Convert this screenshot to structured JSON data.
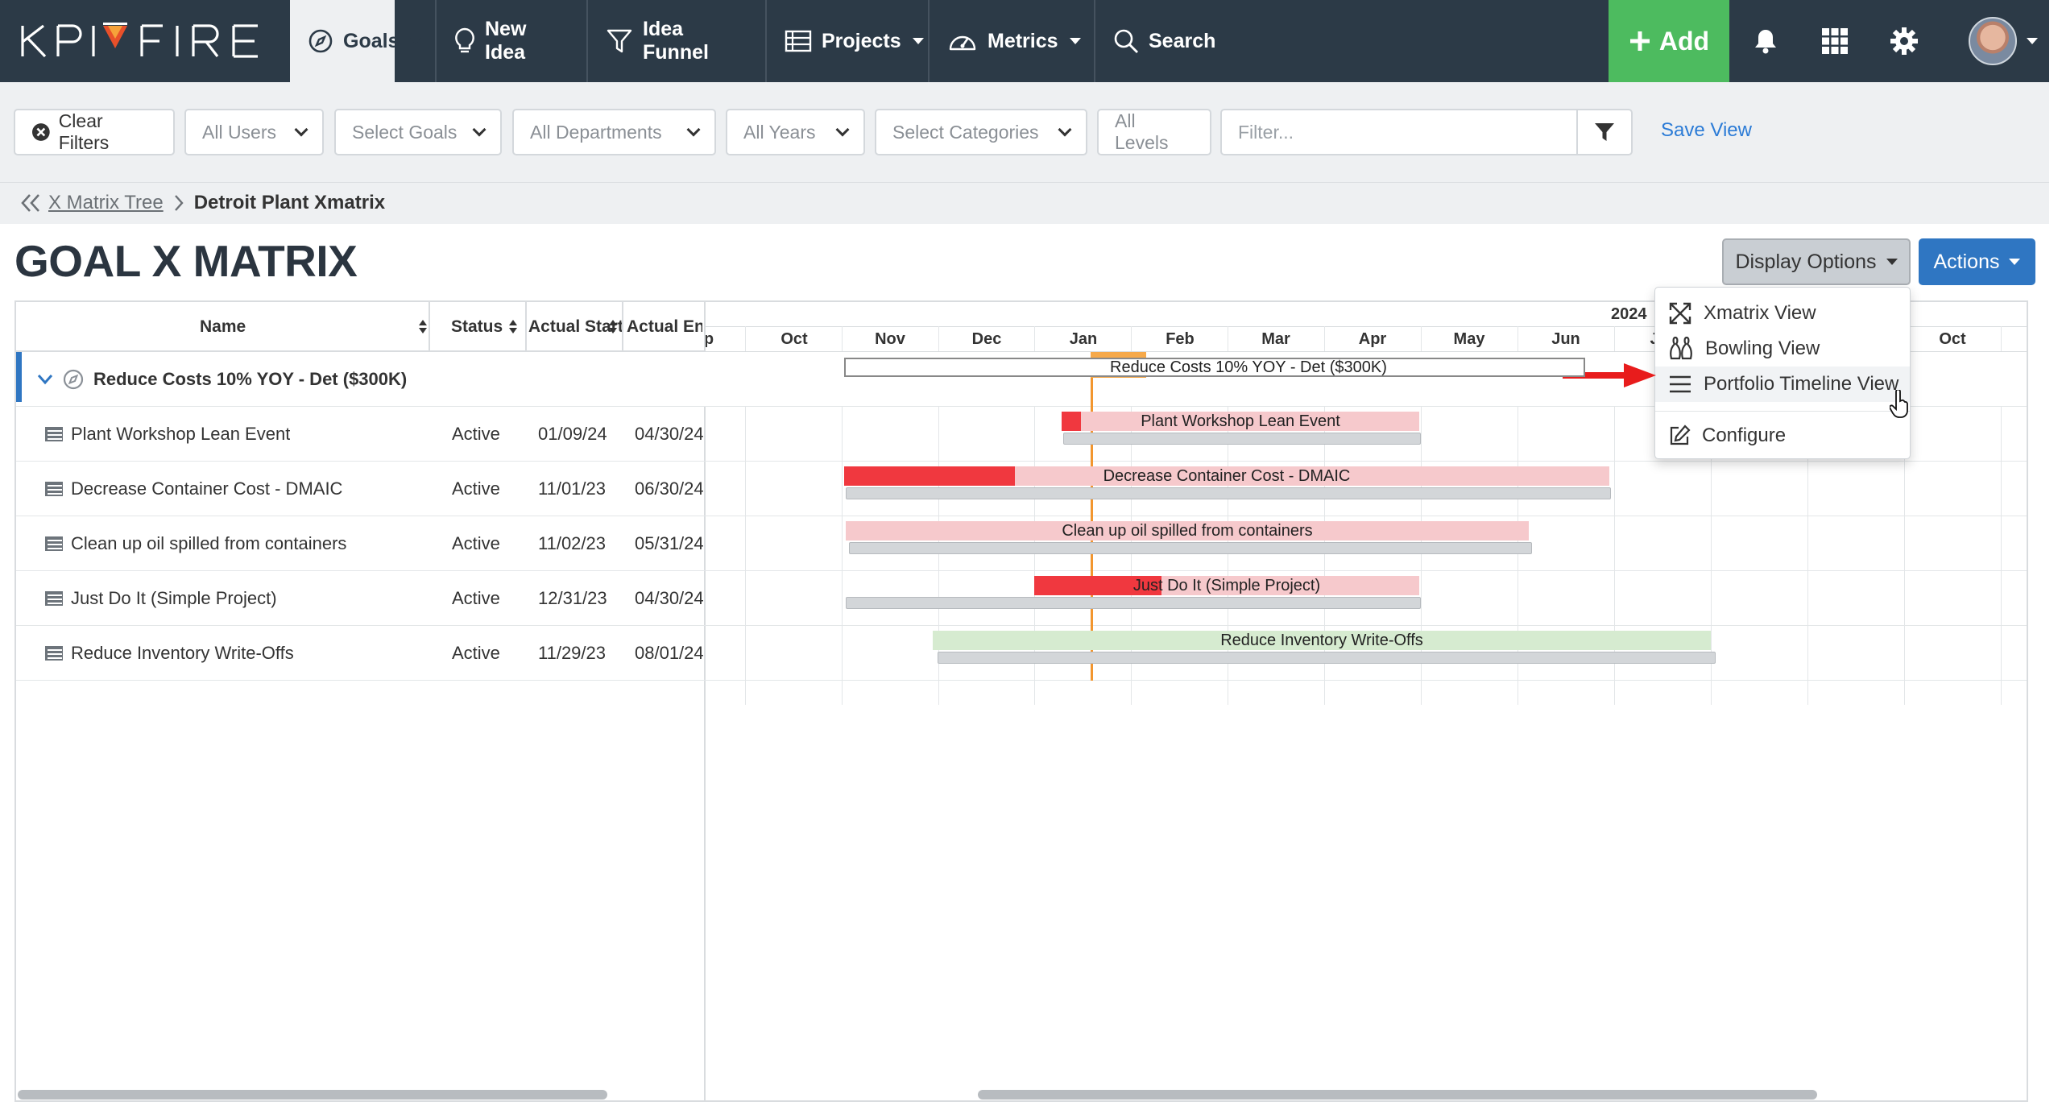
{
  "brand": {
    "name_left": "KPI",
    "name_right": "FIRE",
    "accent": "#e8502a",
    "nav_bg": "#2c3a47",
    "add_green": "#4dbb5f",
    "primary_blue": "#2f76c2",
    "bar_red": "#f0383f",
    "bar_pink": "#f6c9cc",
    "bar_green": "#d6ebd0",
    "today_orange": "#f2962f"
  },
  "nav": {
    "goals": "Goals",
    "new_idea": "New Idea",
    "idea_funnel": "Idea Funnel",
    "projects": "Projects",
    "metrics": "Metrics",
    "search": "Search",
    "add": "Add"
  },
  "filters": {
    "clear": "Clear Filters",
    "users": "All Users",
    "goals": "Select Goals",
    "departments": "All Departments",
    "years": "All Years",
    "categories": "Select Categories",
    "levels": "All Levels",
    "filter_placeholder": "Filter...",
    "save_view": "Save View"
  },
  "breadcrumb": {
    "parent": "X Matrix Tree",
    "current": "Detroit Plant Xmatrix"
  },
  "page": {
    "title": "GOAL X MATRIX",
    "display_options": "Display Options",
    "actions": "Actions"
  },
  "grid": {
    "columns": {
      "name": "Name",
      "status": "Status",
      "actual_start": "Actual Start",
      "actual_end": "Actual En"
    },
    "parent": {
      "name": "Reduce Costs 10% YOY - Det ($300K)"
    },
    "rows": [
      {
        "name": "Plant Workshop Lean Event",
        "status": "Active",
        "start": "01/09/24",
        "end": "04/30/24"
      },
      {
        "name": "Decrease Container Cost - DMAIC",
        "status": "Active",
        "start": "11/01/23",
        "end": "06/30/24"
      },
      {
        "name": "Clean up oil spilled from containers",
        "status": "Active",
        "start": "11/02/23",
        "end": "05/31/24"
      },
      {
        "name": "Just Do It (Simple Project)",
        "status": "Active",
        "start": "12/31/23",
        "end": "04/30/24"
      },
      {
        "name": "Reduce Inventory Write-Offs",
        "status": "Active",
        "start": "11/29/23",
        "end": "08/01/24"
      }
    ]
  },
  "timeline": {
    "year": "2024",
    "months": [
      "p",
      "Oct",
      "Nov",
      "Dec",
      "Jan",
      "Feb",
      "Mar",
      "Apr",
      "May",
      "Jun",
      "J",
      "Oct"
    ],
    "today": "Today",
    "parent_bar": "Reduce Costs 10% YOY - Det ($300K)",
    "bars": [
      "Plant Workshop Lean Event",
      "Decrease Container Cost - DMAIC",
      "Clean up oil spilled from containers",
      "Just Do It (Simple Project)",
      "Reduce Inventory Write-Offs"
    ]
  },
  "display_menu": {
    "xmatrix": "Xmatrix View",
    "bowling": "Bowling View",
    "portfolio": "Portfolio Timeline View",
    "configure": "Configure"
  }
}
